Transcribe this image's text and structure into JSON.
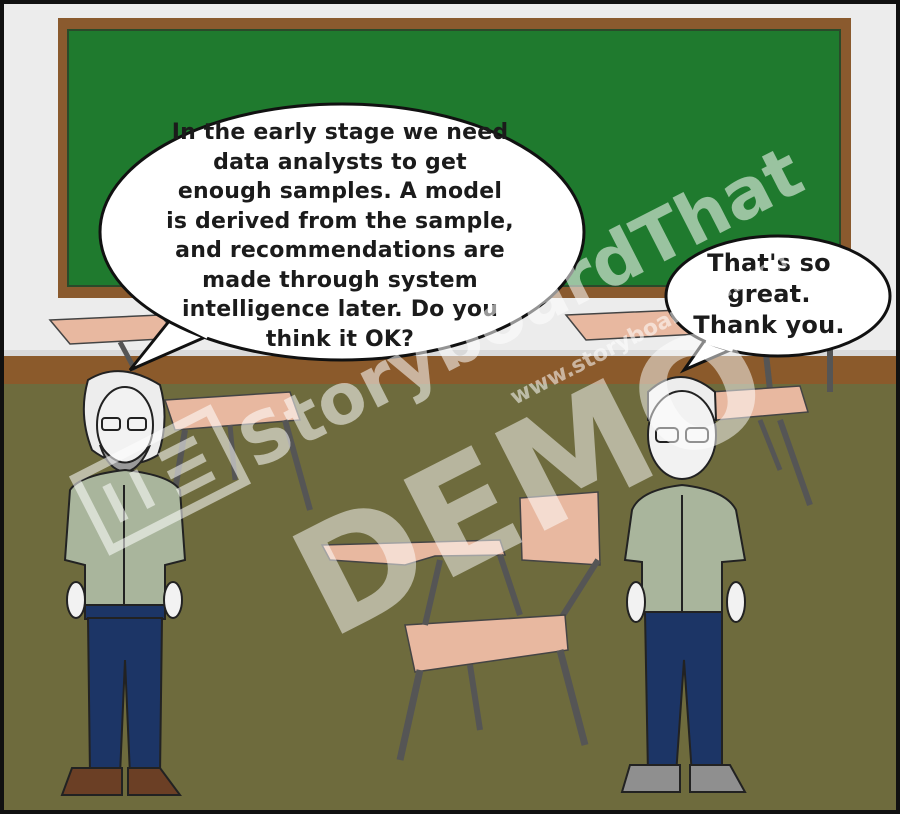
{
  "bubbles": {
    "left": {
      "lines": [
        "In the early stage we need",
        "data analysts to get",
        "enough samples. A model",
        "is derived from the sample,",
        "and recommendations are",
        "made through system",
        "intelligence later.  Do you",
        "think it OK?"
      ]
    },
    "right": {
      "lines": [
        "That's so",
        "great.",
        "Thank you."
      ]
    }
  },
  "watermark": {
    "brand": "StoryboardThat",
    "url": "www.storyboardthat.com",
    "demo": "DEMO"
  },
  "colors": {
    "chalkboard": "#1f7a2e",
    "board_frame": "#8a5a2e",
    "wall": "#ececec",
    "floor": "#6e6b3d",
    "baseboard": "#8b5a2b",
    "chair": "#e8b8a0",
    "shirt": "#a9b59c",
    "jeans": "#1c3566"
  }
}
